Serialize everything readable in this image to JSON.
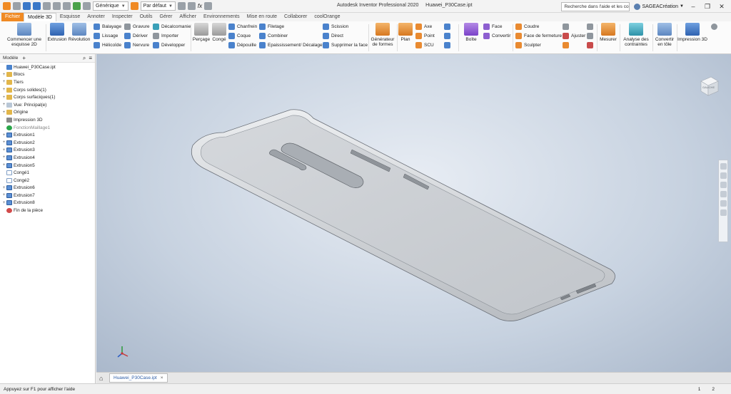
{
  "window": {
    "app_title": "Autodesk Inventor Professional 2020",
    "file_title": "Huawei_P30Case.ipt",
    "search_placeholder": "Recherche dans l'aide et les com",
    "user": "SAGEACréation",
    "min": "–",
    "max": "❐",
    "close": "✕"
  },
  "quick_access": {
    "material": "Générique",
    "appearance": "Par défaut",
    "fx": "fx"
  },
  "tabs": [
    {
      "label": "Fichier"
    },
    {
      "label": "Modèle 3D"
    },
    {
      "label": "Esquisse"
    },
    {
      "label": "Annoter"
    },
    {
      "label": "Inspecter"
    },
    {
      "label": "Outils"
    },
    {
      "label": "Gérer"
    },
    {
      "label": "Afficher"
    },
    {
      "label": "Environnements"
    },
    {
      "label": "Mise en route"
    },
    {
      "label": "Collaborer"
    },
    {
      "label": "coolOrange"
    }
  ],
  "ribbon": {
    "sketch_start": "Commencer une esquisse 2D",
    "extrusion": "Extrusion",
    "revolution": "Révolution",
    "balayage": "Balayage",
    "lissage": "Lissage",
    "helicoide": "Hélicoïde",
    "gravure": "Gravure",
    "deriver": "Dériver",
    "nervure": "Nervure",
    "decalcomanie": "Décalcomanie",
    "importer": "Importer",
    "developper": "Développer",
    "percage": "Perçage",
    "conge": "Congé",
    "chanfrein": "Chanfrein",
    "coque": "Coque",
    "depouille": "Dépouille",
    "filetage": "Filetage",
    "combiner": "Combiner",
    "epaississement": "Epaississement/ Décalage",
    "scission": "Scission",
    "direct": "Direct",
    "supprimer_face": "Supprimer la face",
    "generateur": "Générateur de formes",
    "plan": "Plan",
    "axe": "Axe",
    "point": "Point",
    "scu": "SCU",
    "boite": "Boîte",
    "face": "Face",
    "convertir": "Convertir",
    "coudre": "Coudre",
    "face_fermeture": "Face de fermeture",
    "sculpter": "Sculpter",
    "ajuster": "Ajuster",
    "mesurer": "Mesurer",
    "analyse": "Analyse des contraintes",
    "convertir_tole": "Convertir en tôle",
    "impression3d": "Impression 3D"
  },
  "browser": {
    "title": "Modèle",
    "plus": "+",
    "items": [
      {
        "label": "Huawei_P30Case.ipt",
        "exp": "",
        "icon": "part"
      },
      {
        "label": "Blocs",
        "exp": "+",
        "icon": "folder"
      },
      {
        "label": "Tiers",
        "exp": "+",
        "icon": "folder"
      },
      {
        "label": "Corps solides(1)",
        "exp": "+",
        "icon": "folder"
      },
      {
        "label": "Corps surfaciques(1)",
        "exp": "+",
        "icon": "folder"
      },
      {
        "label": "Vue: Principal(e)",
        "exp": "+",
        "icon": "view"
      },
      {
        "label": "Origine",
        "exp": "+",
        "icon": "folder"
      },
      {
        "label": "Impression 3D",
        "exp": "",
        "icon": "print"
      },
      {
        "label": "FonctionMaillage1",
        "exp": "",
        "icon": "check"
      },
      {
        "label": "Extrusion1",
        "exp": "+",
        "icon": "ext"
      },
      {
        "label": "Extrusion2",
        "exp": "+",
        "icon": "ext"
      },
      {
        "label": "Extrusion3",
        "exp": "+",
        "icon": "ext"
      },
      {
        "label": "Extrusion4",
        "exp": "+",
        "icon": "ext"
      },
      {
        "label": "Extrusion5",
        "exp": "+",
        "icon": "ext"
      },
      {
        "label": "Congé1",
        "exp": "",
        "icon": "fillet"
      },
      {
        "label": "Congé2",
        "exp": "",
        "icon": "fillet"
      },
      {
        "label": "Extrusion6",
        "exp": "+",
        "icon": "ext"
      },
      {
        "label": "Extrusion7",
        "exp": "+",
        "icon": "ext"
      },
      {
        "label": "Extrusion8",
        "exp": "+",
        "icon": "ext"
      },
      {
        "label": "Fin de la pièce",
        "exp": "",
        "icon": "end"
      }
    ]
  },
  "viewcube_label": "GAUCHE",
  "doc_tab": {
    "label": "Huawei_P30Case.ipt",
    "close": "×"
  },
  "status": {
    "message": "Appuyez sur F1 pour afficher l'aide",
    "count1": "1",
    "count2": "2"
  }
}
